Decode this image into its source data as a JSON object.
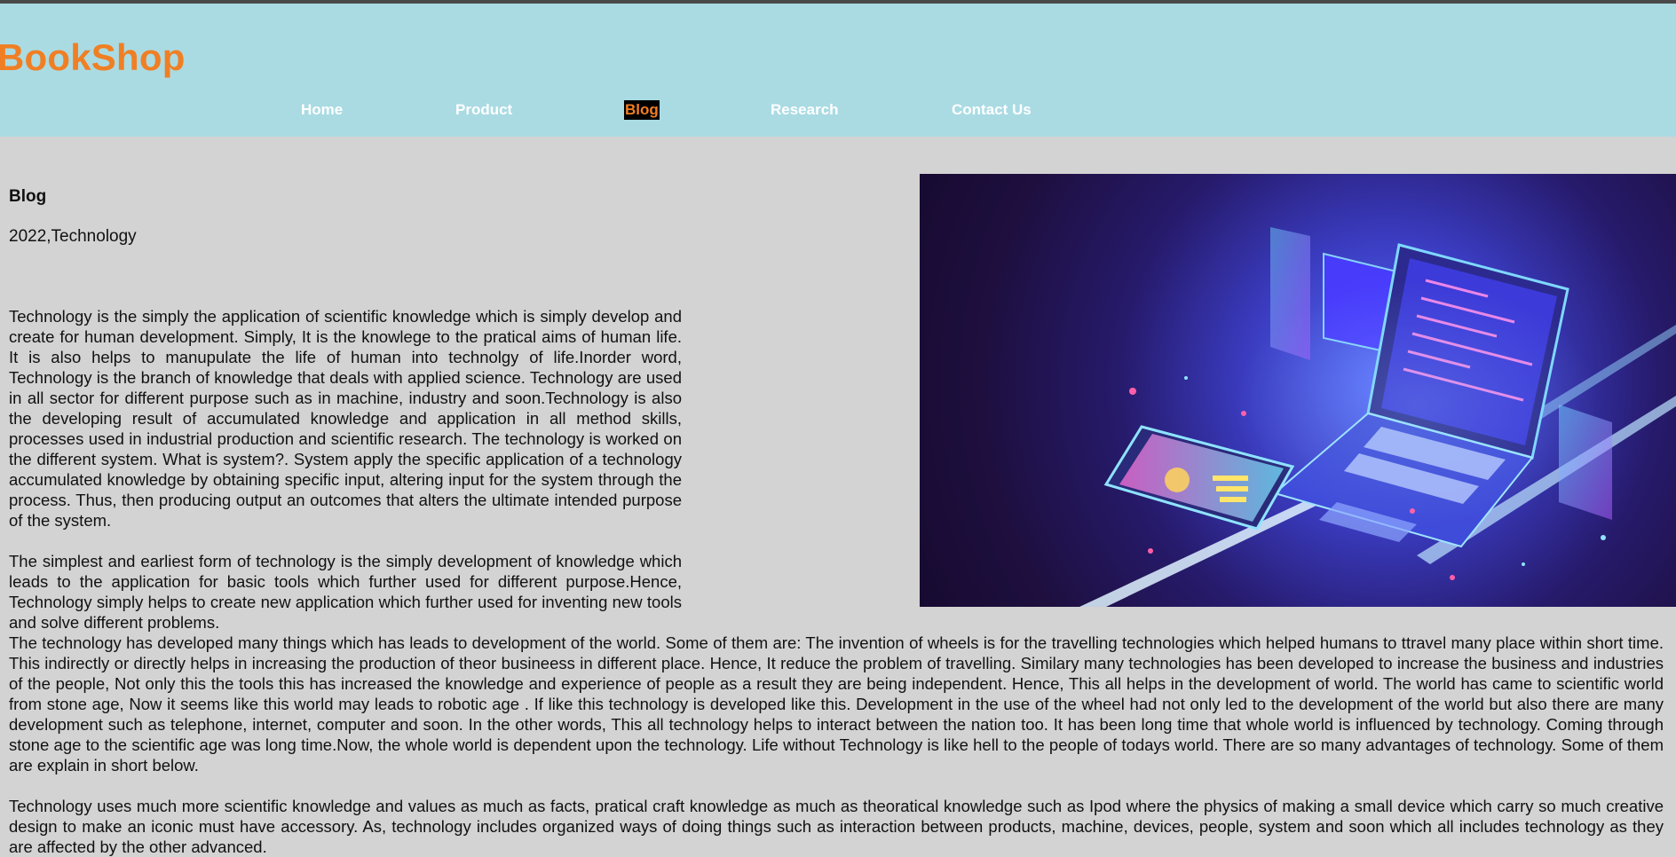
{
  "brand": "BookShop",
  "nav": [
    {
      "label": "Home",
      "active": false
    },
    {
      "label": "Product",
      "active": false
    },
    {
      "label": "Blog",
      "active": true
    },
    {
      "label": "Research",
      "active": false
    },
    {
      "label": "Contact Us",
      "active": false
    }
  ],
  "article": {
    "heading": "Blog",
    "meta": "2022,Technology",
    "paragraphs": [
      "Technology is the simply the application of scientific knowledge which is simply develop and create for human development. Simply, It is the knowlege to the pratical aims of human life. It is also helps to manupulate the life of human into technolgy of life.Inorder word, Technology is the branch of knowledge that deals with applied science. Technology are used in all sector for different purpose such as in machine, industry and soon.Technology is also the developing result of accumulated knowledge and application in all method skills, processes used in industrial production and scientific research. The technology is worked on the different system. What is system?. System apply the specific application of a technology accumulated knowledge by obtaining specific input, altering input for the system through the process. Thus, then producing output an outcomes that alters the ultimate intended purpose of the system.",
      "The simplest and earliest form of technology is the simply development of knowledge which leads to the application for basic tools which further used for different purpose.Hence, Technology simply helps to create new application which further used for inventing new tools and solve different problems.",
      "The technology has developed many things which has leads to development of the world. Some of them are: The invention of wheels is for the travelling technologies which helped humans to ttravel many place within short time. This indirectly or directly helps in increasing the production of theor busineess in different place. Hence, It reduce the problem of travelling. Similary many technologies has been developed to increase the business and industries of the people, Not only this the tools this has increased the knowledge and experience of people as a result they are being independent. Hence, This all helps in the development of world. The world has came to scientific world from stone age, Now it seems like this world may leads to robotic age . If like this technology is developed like this. Development in the use of the wheel had not only led to the development of the world but also there are many development such as telephone, internet, computer and soon. In the other words, This all technology helps to interact between the nation too. It has been long time that whole world is influenced by technology. Coming through stone age to the scientific age was long time.Now, the whole world is dependent upon the technology. Life without Technology is like hell to the people of todays world. There are so many advantages of technology. Some of them are explain in short below.",
      "Technology uses much more scientific knowledge and values as much as facts, pratical craft knowledge as much as theoratical knowledge such as Ipod where the physics of making a small device which carry so much creative design to make an iconic must have accessory. As, technology includes organized ways of doing things such as interaction between products, machine, devices, people, system and soon which all includes technology as they are affected by the other advanced."
    ]
  },
  "colors": {
    "header_bg": "#aadbe3",
    "page_bg": "#d3d3d3",
    "brand": "#f07f24",
    "nav_text": "#ffffff",
    "nav_active_bg": "#000000"
  },
  "hero_image": {
    "description_icon": "laptop-technology-illustration"
  }
}
